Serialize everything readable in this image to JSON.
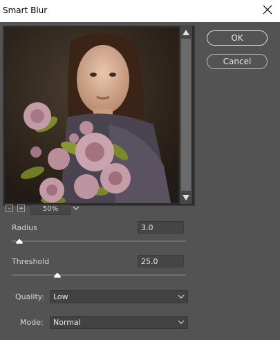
{
  "dialog": {
    "title": "Smart Blur"
  },
  "preview": {
    "zoom_minus": "-",
    "zoom_plus": "+",
    "zoom_value": "50%"
  },
  "buttons": {
    "ok_label": "OK",
    "cancel_label": "Cancel"
  },
  "radius": {
    "label": "Radius",
    "value": "3.0",
    "slider_fraction": 0.03
  },
  "threshold": {
    "label": "Threshold",
    "value": "25.0",
    "slider_fraction": 0.25
  },
  "quality": {
    "label": "Quality:",
    "value": "Low"
  },
  "mode": {
    "label": "Mode:",
    "value": "Normal"
  },
  "colors": {
    "bg": "#535353",
    "titlebar": "#ffffff"
  },
  "icons": [
    "close-icon",
    "scroll-up-icon",
    "scroll-down-icon",
    "chevron-down-icon"
  ]
}
